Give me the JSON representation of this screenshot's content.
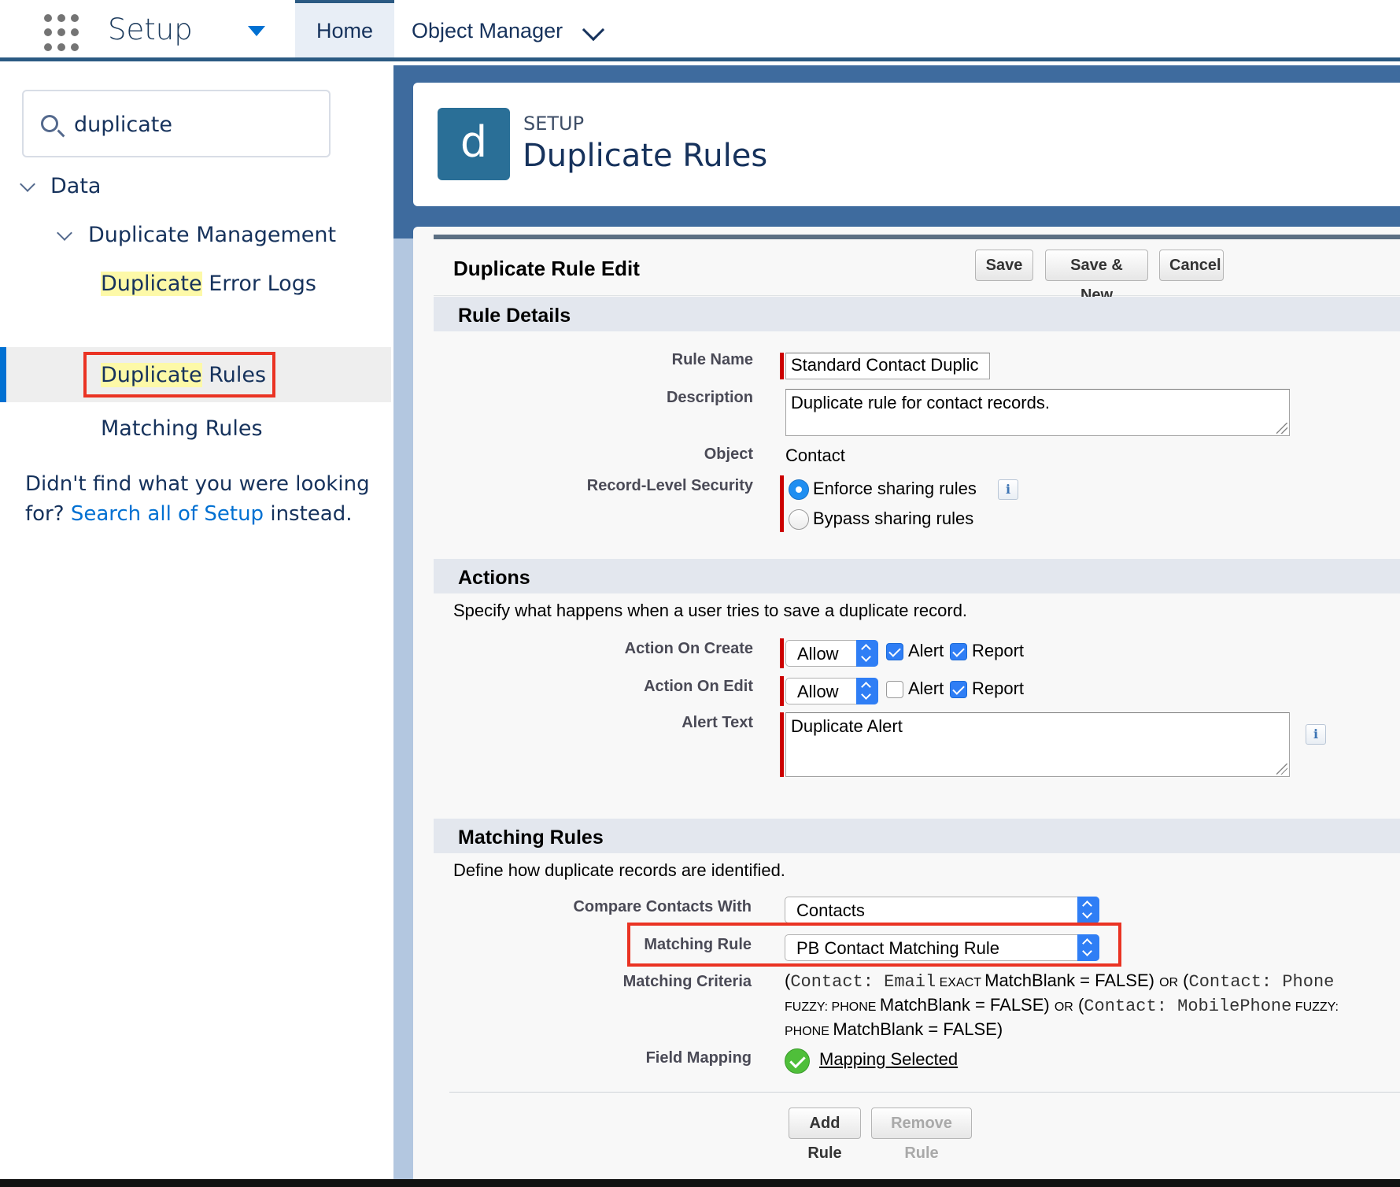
{
  "topbar": {
    "app_title": "Setup",
    "tabs": [
      {
        "label": "Home"
      },
      {
        "label": "Object Manager"
      }
    ]
  },
  "sidebar": {
    "search": {
      "value": "duplicate"
    },
    "tree": {
      "data": "Data",
      "duplicate_management": "Duplicate Management",
      "items": [
        {
          "highlight": "Duplicate",
          "rest": " Error Logs"
        },
        {
          "highlight": "Duplicate",
          "rest": " Rules"
        },
        {
          "highlight": "",
          "rest": "Matching Rules"
        }
      ]
    },
    "not_found": {
      "prefix": "Didn't find what you were looking for? ",
      "link": "Search all of Setup",
      "suffix": " instead."
    }
  },
  "header": {
    "icon_letter": "d",
    "eyebrow": "SETUP",
    "title": "Duplicate Rules",
    "icon_color": "#2a6f97"
  },
  "panel": {
    "title": "Duplicate Rule Edit",
    "buttons": {
      "save": "Save",
      "save_new": "Save & New",
      "cancel": "Cancel"
    }
  },
  "rule_details": {
    "heading": "Rule Details",
    "rule_name_label": "Rule Name",
    "rule_name_value": "Standard Contact Duplic",
    "description_label": "Description",
    "description_value": "Duplicate rule for contact records.",
    "object_label": "Object",
    "object_value": "Contact",
    "security_label": "Record-Level Security",
    "security_options": [
      "Enforce sharing rules",
      "Bypass sharing rules"
    ],
    "security_selected": "Enforce sharing rules",
    "info_glyph": "i"
  },
  "actions": {
    "heading": "Actions",
    "description": "Specify what happens when a user tries to save a duplicate record.",
    "on_create_label": "Action On Create",
    "on_create_value": "Allow",
    "on_create_alert": true,
    "on_create_report": true,
    "on_edit_label": "Action On Edit",
    "on_edit_value": "Allow",
    "on_edit_alert": false,
    "on_edit_report": true,
    "alert_label": "Alert",
    "report_label": "Report",
    "alert_text_label": "Alert Text",
    "alert_text_value": "Duplicate Alert"
  },
  "matching": {
    "heading": "Matching Rules",
    "description": "Define how duplicate records are identified.",
    "compare_label": "Compare Contacts With",
    "compare_value": "Contacts",
    "rule_label": "Matching Rule",
    "rule_value": "PB Contact Matching Rule",
    "criteria_label": "Matching Criteria",
    "criteria": {
      "open1": "(",
      "f1": "Contact: Email",
      "m1": " EXACT ",
      "mb1": "MatchBlank = FALSE) ",
      "or1": "OR",
      "open2": " (",
      "f2": "Contact: Phone",
      "m2": " FUZZY: PHONE ",
      "mb2": "MatchBlank = FALSE) ",
      "or2": "OR",
      "open3": " (",
      "f3": "Contact: MobilePhone",
      "m3": " FUZZY: PHONE ",
      "mb3": "MatchBlank = FALSE)"
    },
    "mapping_label": "Field Mapping",
    "mapping_value": "Mapping Selected",
    "add_rule": "Add Rule",
    "remove_rule": "Remove Rule"
  },
  "colors": {
    "brand_blue": "#0070d2",
    "highlight_red": "#ea3323",
    "required_red": "#cc0000"
  }
}
